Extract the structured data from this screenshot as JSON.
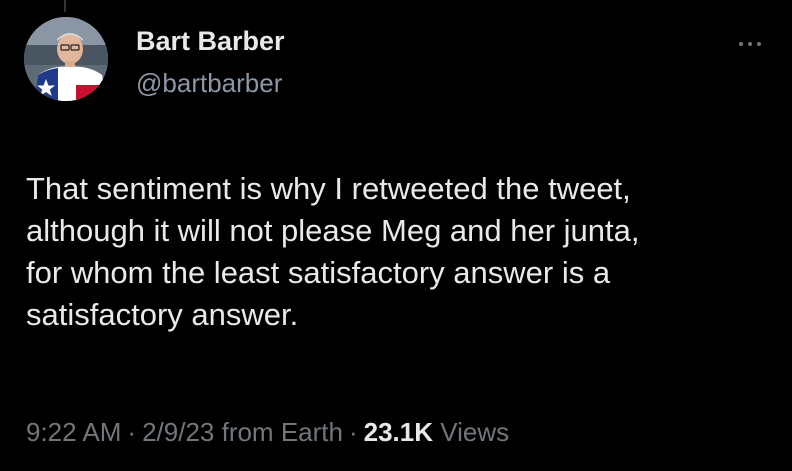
{
  "author": {
    "display_name": "Bart Barber",
    "handle": "@bartbarber",
    "avatar_icon": "profile-photo"
  },
  "more_icon": "ellipsis-icon",
  "tweet": {
    "text_lines": [
      "That sentiment is why I retweeted the tweet,",
      "although it will not please Meg and her junta,",
      "for whom the least satisfactory answer is a",
      "satisfactory answer."
    ]
  },
  "meta": {
    "time": "9:22 AM",
    "separator": "·",
    "date_location": "2/9/23 from Earth",
    "views_count": "23.1K",
    "views_label": "Views"
  },
  "colors": {
    "background": "#000000",
    "primary_text": "#e7e9ea",
    "secondary_text": "#71767b"
  }
}
